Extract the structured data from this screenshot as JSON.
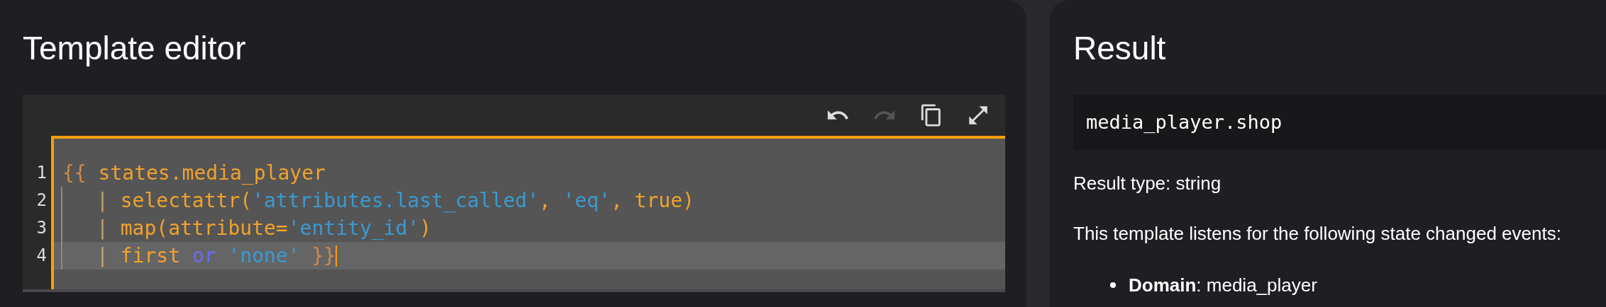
{
  "editor": {
    "title": "Template editor",
    "toolbar": [
      {
        "kind": "undo",
        "disabled": false
      },
      {
        "kind": "redo",
        "disabled": true
      },
      {
        "kind": "copy",
        "disabled": false
      },
      {
        "kind": "fullscreen",
        "disabled": false
      }
    ],
    "lines": [
      {
        "number": "1",
        "indented": false,
        "active": false,
        "tokens": [
          {
            "kind": "delim",
            "text": "{{ "
          },
          {
            "kind": "ident",
            "text": "states.media_player"
          }
        ]
      },
      {
        "number": "2",
        "indented": true,
        "active": false,
        "tokens": [
          {
            "kind": "pipe",
            "text": "| "
          },
          {
            "kind": "ident",
            "text": "selectattr("
          },
          {
            "kind": "string",
            "text": "'attributes.last_called'"
          },
          {
            "kind": "ident",
            "text": ", "
          },
          {
            "kind": "string",
            "text": "'eq'"
          },
          {
            "kind": "ident",
            "text": ", true)"
          }
        ]
      },
      {
        "number": "3",
        "indented": true,
        "active": false,
        "tokens": [
          {
            "kind": "pipe",
            "text": "| "
          },
          {
            "kind": "ident",
            "text": "map(attribute="
          },
          {
            "kind": "string",
            "text": "'entity_id'"
          },
          {
            "kind": "ident",
            "text": ")"
          }
        ]
      },
      {
        "number": "4",
        "indented": true,
        "active": true,
        "tokens": [
          {
            "kind": "pipe",
            "text": "| "
          },
          {
            "kind": "ident",
            "text": "first "
          },
          {
            "kind": "keyword",
            "text": "or "
          },
          {
            "kind": "string",
            "text": "'none'"
          },
          {
            "kind": "delim",
            "text": " }}"
          }
        ]
      }
    ]
  },
  "result": {
    "title": "Result",
    "value": "media_player.shop",
    "type_line": "Result type: string",
    "listens_text": "This template listens for the following state changed events:",
    "events": [
      "**Domain**: media_player"
    ]
  }
}
